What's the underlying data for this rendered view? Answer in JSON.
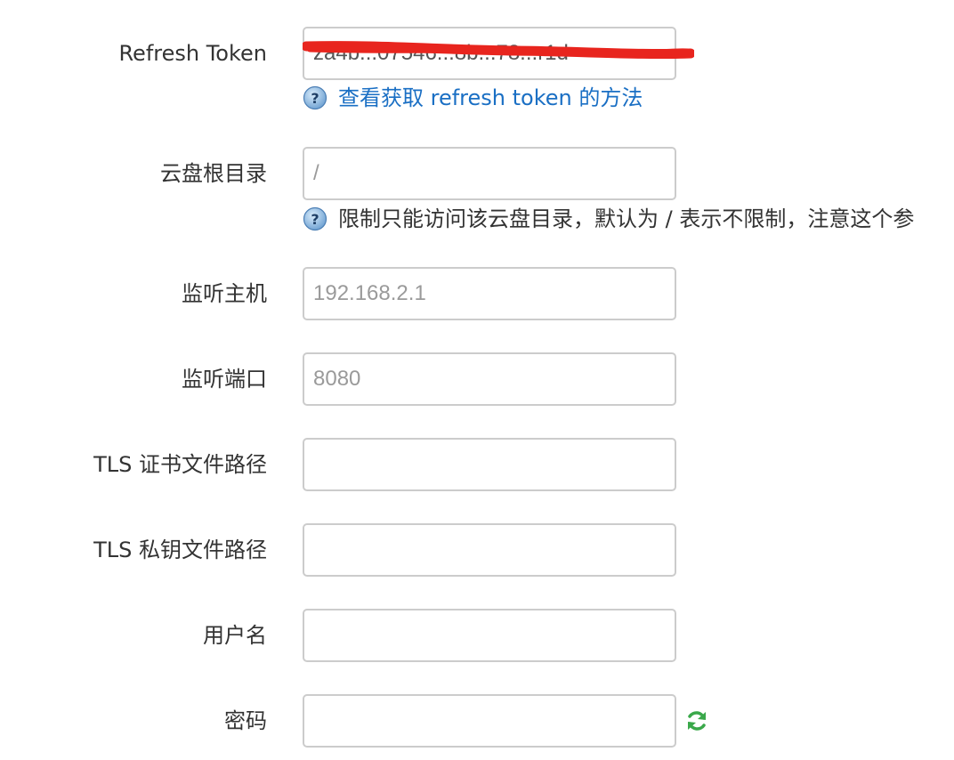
{
  "fields": {
    "refresh_token": {
      "label": "Refresh Token",
      "value": "za4b...07546...8b...78...r1d",
      "help": "查看获取 refresh token 的方法"
    },
    "root_dir": {
      "label": "云盘根目录",
      "value": "",
      "placeholder": "/",
      "help": "限制只能访问该云盘目录，默认为 / 表示不限制，注意这个参"
    },
    "listen_host": {
      "label": "监听主机",
      "value": "",
      "placeholder": "192.168.2.1"
    },
    "listen_port": {
      "label": "监听端口",
      "value": "",
      "placeholder": "8080"
    },
    "tls_cert": {
      "label": "TLS 证书文件路径",
      "value": ""
    },
    "tls_key": {
      "label": "TLS 私钥文件路径",
      "value": ""
    },
    "username": {
      "label": "用户名",
      "value": ""
    },
    "password": {
      "label": "密码",
      "value": ""
    }
  },
  "icons": {
    "help": "help-circle-icon",
    "refresh": "refresh-icon",
    "redaction": "red-scribble"
  },
  "colors": {
    "link": "#1a6fc4",
    "label": "#333333",
    "border": "#cccccc",
    "redaction": "#e8251e",
    "refresh_icon": "#3aa84a"
  }
}
